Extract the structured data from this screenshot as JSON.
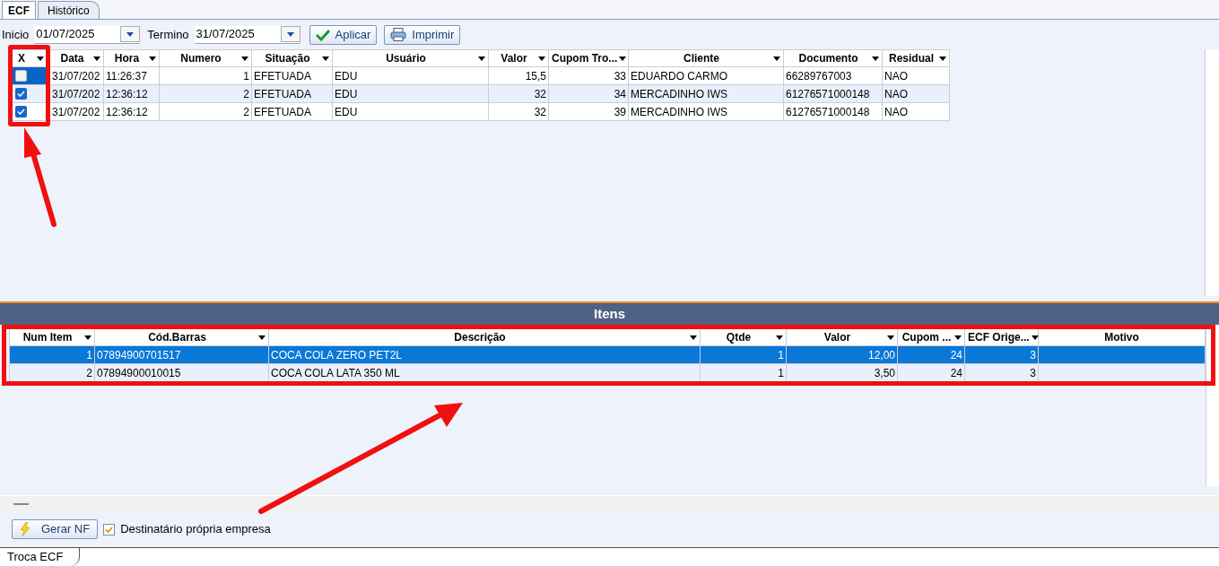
{
  "tabs": [
    {
      "label": "ECF",
      "selected": true
    },
    {
      "label": "Histórico",
      "selected": false
    }
  ],
  "filters": {
    "start_label": "Inicio",
    "start_value": "01/07/2025",
    "end_label": "Termino",
    "end_value": "31/07/2025"
  },
  "buttons": [
    {
      "label": "Aplicar",
      "kind": "apply"
    },
    {
      "label": "Imprimir",
      "kind": "print"
    }
  ],
  "ecf_table": {
    "columns": [
      {
        "label": "X",
        "filter": true
      },
      {
        "label": "Data",
        "filter": true
      },
      {
        "label": "Hora",
        "filter": true
      },
      {
        "label": "Numero",
        "filter": true
      },
      {
        "label": "Situação",
        "filter": true
      },
      {
        "label": "Usuário",
        "filter": true
      },
      {
        "label": "Valor",
        "filter": true
      },
      {
        "label": "Cupom Tro...",
        "filter": true
      },
      {
        "label": "Cliente",
        "filter": true
      },
      {
        "label": "Documento",
        "filter": true
      },
      {
        "label": "Residual",
        "filter": true
      }
    ],
    "rows": [
      {
        "selected": true,
        "checked": false,
        "cells": [
          "",
          "31/07/202",
          "11:26:37",
          "1",
          "EFETUADA",
          "EDU",
          "15,5",
          "33",
          "EDUARDO CARMO",
          "66289767003",
          "NAO"
        ]
      },
      {
        "selected": false,
        "checked": true,
        "cells": [
          "",
          "31/07/202",
          "12:36:12",
          "2",
          "EFETUADA",
          "EDU",
          "32",
          "34",
          "MERCADINHO IWS",
          "61276571000148",
          "NAO"
        ]
      },
      {
        "selected": false,
        "checked": true,
        "cells": [
          "",
          "31/07/202",
          "12:36:12",
          "2",
          "EFETUADA",
          "EDU",
          "32",
          "39",
          "MERCADINHO IWS",
          "61276571000148",
          "NAO"
        ]
      }
    ]
  },
  "items_panel": {
    "title": "Itens",
    "columns": [
      {
        "label": "Num Item",
        "filter": true
      },
      {
        "label": "Cód.Barras",
        "filter": true
      },
      {
        "label": "Descrição",
        "filter": true
      },
      {
        "label": "Qtde",
        "filter": true
      },
      {
        "label": "Valor",
        "filter": true
      },
      {
        "label": "Cupom ...",
        "filter": true
      },
      {
        "label": "ECF Orige...",
        "filter": true
      },
      {
        "label": "Motivo",
        "filter": false
      }
    ],
    "rows": [
      {
        "selected": true,
        "cells": [
          "1",
          "07894900701517",
          "COCA COLA ZERO PET2L",
          "1",
          "12,00",
          "24",
          "3",
          ""
        ]
      },
      {
        "selected": false,
        "cells": [
          "2",
          "07894900010015",
          "COCA COLA LATA 350 ML",
          "1",
          "3,50",
          "24",
          "3",
          ""
        ]
      }
    ]
  },
  "footer": {
    "button": "Gerar NF",
    "checkbox": {
      "label": "Destinatário própria empresa",
      "checked": true
    }
  },
  "bottom_tabs": [
    {
      "label": "Troca ECF",
      "selected": true
    }
  ]
}
